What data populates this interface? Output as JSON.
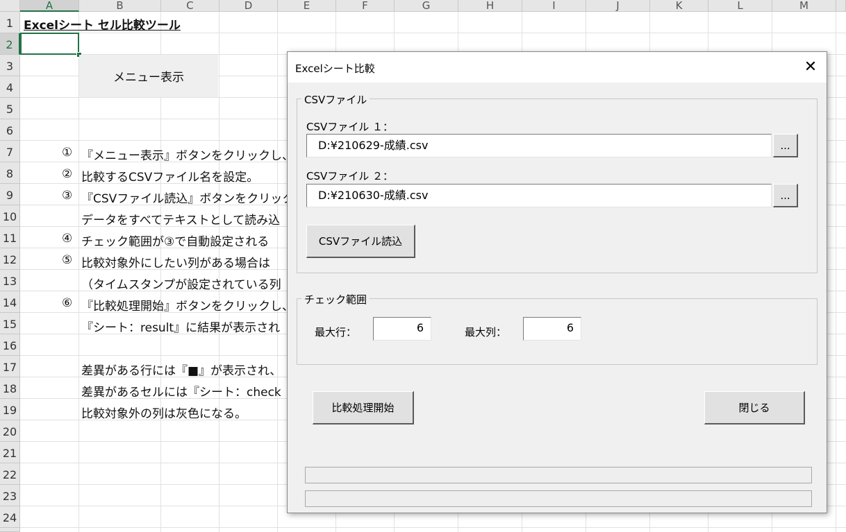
{
  "columns": [
    "A",
    "B",
    "C",
    "D",
    "E",
    "F",
    "G",
    "H",
    "I",
    "J",
    "K",
    "L",
    "M"
  ],
  "rows": [
    "1",
    "2",
    "3",
    "4",
    "5",
    "6",
    "7",
    "8",
    "9",
    "10",
    "11",
    "12",
    "13",
    "14",
    "15",
    "16",
    "17",
    "18",
    "19",
    "20",
    "21",
    "22",
    "23",
    "24"
  ],
  "sheet": {
    "title": "Excelシート セル比較ツール",
    "menu_button": "メニュー表示",
    "circled": {
      "r7": "①",
      "r8": "②",
      "r9": "③",
      "r11": "④",
      "r12": "⑤",
      "r14": "⑥"
    },
    "lines": {
      "r7": "『メニュー表示』ボタンをクリックし、メ",
      "r8": "比較するCSVファイル名を設定。",
      "r9": "『CSVファイル読込』ボタンをクリック",
      "r10": "データをすべてテキストとして読み込",
      "r11": "チェック範囲が③で自動設定される",
      "r12": "比較対象外にしたい列がある場合は",
      "r13": "（タイムスタンプが設定されている列",
      "r14": "『比較処理開始』ボタンをクリックし、",
      "r15": "『シート：result』に結果が表示され",
      "r17": "差異がある行には『■』が表示され、",
      "r18": "差異があるセルには『シート：check",
      "r19": "比較対象外の列は灰色になる。"
    }
  },
  "dialog": {
    "title": "Excelシート比較",
    "close": "✕",
    "csv_group": "CSVファイル",
    "file1_label": "CSVファイル １：",
    "file1_value": "D:¥210629-成績.csv",
    "file2_label": "CSVファイル ２：",
    "file2_value": "D:¥210630-成績.csv",
    "browse": "...",
    "load_button": "CSVファイル読込",
    "range_group": "チェック範囲",
    "max_row_label": "最大行：",
    "max_row_value": "6",
    "max_col_label": "最大列：",
    "max_col_value": "6",
    "start_button": "比較処理開始",
    "close_button": "閉じる"
  }
}
